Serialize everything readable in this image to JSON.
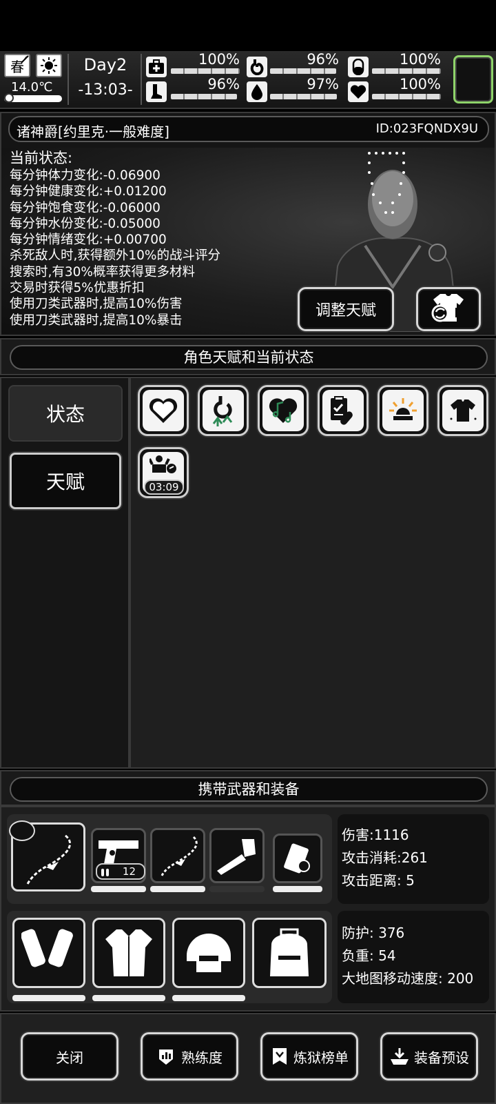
{
  "hud": {
    "season": "春",
    "temperature": "14.0℃",
    "day": "Day2",
    "time": "-13:03-",
    "stats": [
      {
        "icon": "medkit-icon",
        "value": "100%",
        "level": 1.0
      },
      {
        "icon": "stomach-icon",
        "value": "96%",
        "level": 0.96
      },
      {
        "icon": "capsule-icon",
        "value": "100%",
        "level": 1.0
      },
      {
        "icon": "leg-icon",
        "value": "96%",
        "level": 0.96
      },
      {
        "icon": "water-drop-icon",
        "value": "97%",
        "level": 0.97
      },
      {
        "icon": "heart-icon",
        "value": "100%",
        "level": 1.0
      }
    ]
  },
  "character": {
    "name": "诸神爵[约里克·一般难度]",
    "id": "ID:023FQNDX9U",
    "status_title": "当前状态:",
    "status_lines": [
      "每分钟体力变化:-0.06900",
      "每分钟健康变化:+0.01200",
      "每分钟饱食变化:-0.06000",
      "每分钟水份变化:-0.05000",
      "每分钟情绪变化:+0.00700",
      "杀死敌人时,获得额外10%的战斗评分",
      "搜索时,有30%概率获得更多材料",
      "交易时获得5%优惠折扣",
      "使用刀类武器时,提高10%伤害",
      "使用刀类武器时,提高10%暴击"
    ],
    "adjust_talent_label": "调整天赋"
  },
  "talents_section": {
    "title": "角色天赋和当前状态",
    "tabs": [
      "状态",
      "天赋"
    ],
    "buff_timer": "03:09"
  },
  "equipment_section": {
    "title": "携带武器和装备",
    "ammo_count": "12",
    "weapon_stats": [
      "伤害:1116",
      "攻击消耗:261",
      "攻击距离: 5"
    ],
    "armor_stats": [
      "防护: 376",
      "负重: 54",
      "大地图移动速度: 200"
    ]
  },
  "bottom_buttons": [
    "关闭",
    "熟练度",
    "炼狱榜单",
    "装备预设"
  ]
}
